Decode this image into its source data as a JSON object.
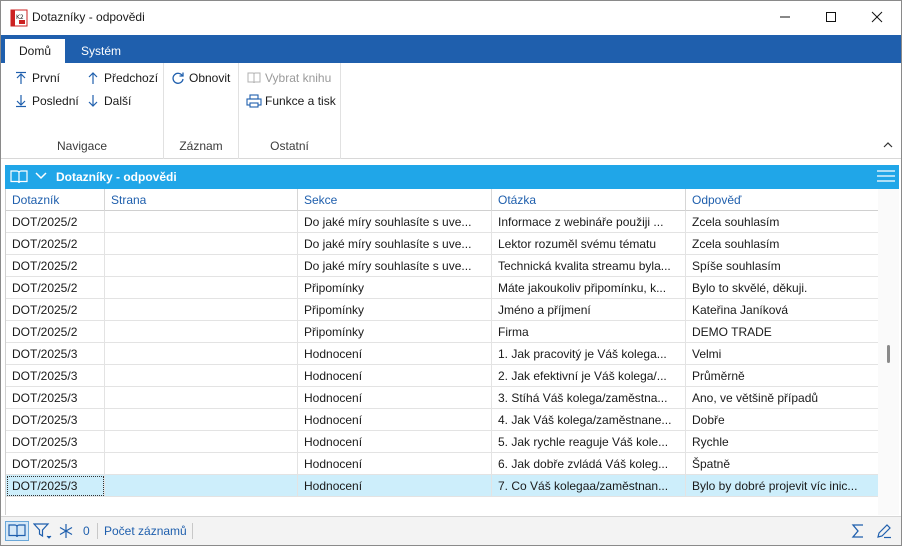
{
  "window": {
    "title": "Dotazníky - odpovědi",
    "app_icon": "k2-app-icon"
  },
  "ribbon": {
    "tabs": [
      {
        "label": "Domů",
        "active": true
      },
      {
        "label": "Systém",
        "active": false
      }
    ],
    "groups": {
      "navigace": {
        "title": "Navigace",
        "first": "První",
        "previous": "Předchozí",
        "last": "Poslední",
        "next": "Další"
      },
      "zaznam": {
        "title": "Záznam",
        "refresh": "Obnovit"
      },
      "ostatni": {
        "title": "Ostatní",
        "select_book": "Vybrat knihu",
        "functions_print": "Funkce a tisk"
      }
    }
  },
  "panel": {
    "title": "Dotazníky - odpovědi"
  },
  "grid": {
    "columns": [
      "Dotazník",
      "Strana",
      "Sekce",
      "Otázka",
      "Odpověď"
    ],
    "rows": [
      [
        "DOT/2025/2",
        "",
        "Do jaké míry souhlasíte s uve...",
        "Informace z webináře použiji ...",
        "Zcela souhlasím"
      ],
      [
        "DOT/2025/2",
        "",
        "Do jaké míry souhlasíte s uve...",
        "Lektor rozuměl svému tématu",
        "Zcela souhlasím"
      ],
      [
        "DOT/2025/2",
        "",
        "Do jaké míry souhlasíte s uve...",
        "Technická kvalita streamu byla...",
        "Spíše souhlasím"
      ],
      [
        "DOT/2025/2",
        "",
        "Připomínky",
        "Máte jakoukoliv připomínku, k...",
        "Bylo to skvělé, děkuji."
      ],
      [
        "DOT/2025/2",
        "",
        "Připomínky",
        "Jméno a příjmení",
        "Kateřina Janíková"
      ],
      [
        "DOT/2025/2",
        "",
        "Připomínky",
        "Firma",
        "DEMO TRADE"
      ],
      [
        "DOT/2025/3",
        "",
        "Hodnocení",
        "1. Jak pracovitý je Váš kolega...",
        "Velmi"
      ],
      [
        "DOT/2025/3",
        "",
        "Hodnocení",
        "2. Jak efektivní je Váš kolega/...",
        "Průměrně"
      ],
      [
        "DOT/2025/3",
        "",
        "Hodnocení",
        " 3. Stíhá Váš kolega/zaměstna...",
        "Ano, ve většině případů"
      ],
      [
        "DOT/2025/3",
        "",
        "Hodnocení",
        "4. Jak Váš kolega/zaměstnane...",
        "Dobře"
      ],
      [
        "DOT/2025/3",
        "",
        "Hodnocení",
        "5. Jak rychle reaguje Váš kole...",
        "Rychle"
      ],
      [
        "DOT/2025/3",
        "",
        "Hodnocení",
        "6. Jak dobře zvládá Váš koleg...",
        "Špatně"
      ],
      [
        "DOT/2025/3",
        "",
        "Hodnocení",
        "7. Co Váš kolegaa/zaměstnan...",
        "Bylo by dobré projevit víc inic..."
      ]
    ],
    "selected_row": 12
  },
  "status": {
    "filter_count": "0",
    "record_count_label": "Počet záznamů"
  },
  "colors": {
    "ribbon_blue": "#1f5fad",
    "panel_header": "#20a6e8",
    "selected_row": "#cdeefb"
  }
}
